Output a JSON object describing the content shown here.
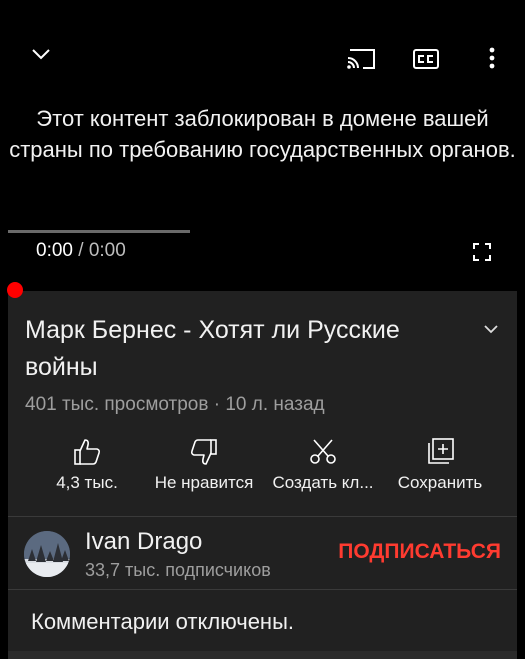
{
  "player": {
    "blocked_message": "Этот контент заблокирован в домене вашей страны по требованию государственных органов.",
    "current_time": "0:00",
    "separator": " / ",
    "duration": "0:00",
    "icons": [
      "chevron-down-icon",
      "cast-icon",
      "captions-icon",
      "more-vert-icon",
      "fullscreen-icon"
    ]
  },
  "video": {
    "title": "Марк Бернес - Хотят ли Русские войны",
    "views": "401 тыс. просмотров",
    "dot": " · ",
    "age": "10 л. назад"
  },
  "actions": {
    "like_label": "4,3 тыс.",
    "dislike_label": "Не нравится",
    "clip_label": "Создать кл...",
    "save_label": "Сохранить"
  },
  "channel": {
    "name": "Ivan Drago",
    "subscribers": "33,7 тыс. подписчиков",
    "subscribe_label": "ПОДПИСАТЬСЯ"
  },
  "comments": {
    "status": "Комментарии отключены."
  },
  "colors": {
    "accent_red": "#ff3b30",
    "progress_dot": "#ff0000",
    "panel_bg": "#212121"
  }
}
